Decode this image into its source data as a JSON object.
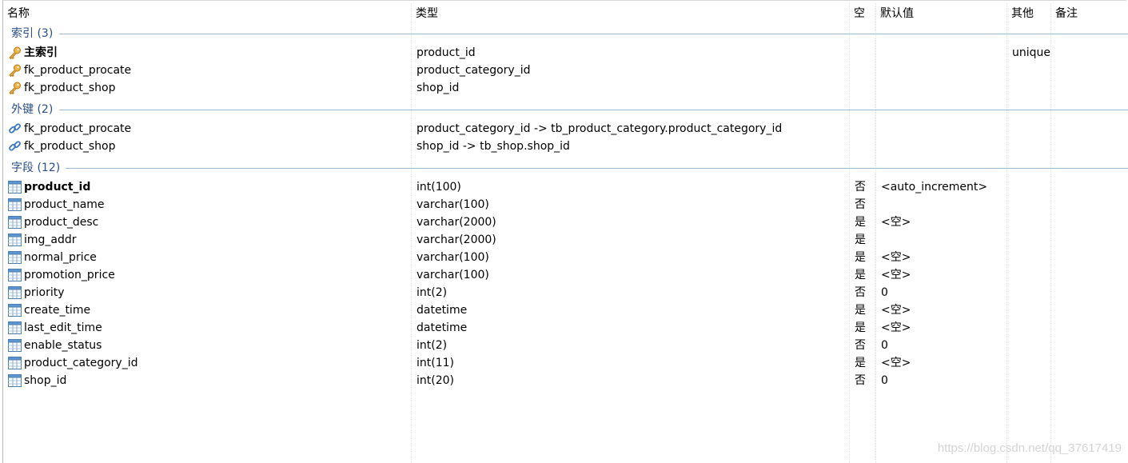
{
  "columns": {
    "name": "名称",
    "type": "类型",
    "null": "空",
    "default": "默认值",
    "other": "其他",
    "comment": "备注"
  },
  "groups": {
    "indexes": "索引 (3)",
    "foreign_keys": "外键 (2)",
    "fields": "字段 (12)"
  },
  "indexes": [
    {
      "name": "主索引",
      "type": "product_id",
      "other": "unique",
      "icon": "key-icon"
    },
    {
      "name": "fk_product_procate",
      "type": "product_category_id",
      "other": "",
      "icon": "key-icon"
    },
    {
      "name": "fk_product_shop",
      "type": "shop_id",
      "other": "",
      "icon": "key-icon"
    }
  ],
  "foreign_keys": [
    {
      "name": "fk_product_procate",
      "type": "product_category_id -> tb_product_category.product_category_id",
      "icon": "link-icon"
    },
    {
      "name": "fk_product_shop",
      "type": "shop_id -> tb_shop.shop_id",
      "icon": "link-icon"
    }
  ],
  "fields": [
    {
      "name": "product_id",
      "type": "int(100)",
      "null": "否",
      "default": "<auto_increment>"
    },
    {
      "name": "product_name",
      "type": "varchar(100)",
      "null": "否",
      "default": ""
    },
    {
      "name": "product_desc",
      "type": "varchar(2000)",
      "null": "是",
      "default": "<空>"
    },
    {
      "name": "img_addr",
      "type": "varchar(2000)",
      "null": "是",
      "default": ""
    },
    {
      "name": "normal_price",
      "type": "varchar(100)",
      "null": "是",
      "default": "<空>"
    },
    {
      "name": "promotion_price",
      "type": "varchar(100)",
      "null": "是",
      "default": "<空>"
    },
    {
      "name": "priority",
      "type": "int(2)",
      "null": "否",
      "default": "0"
    },
    {
      "name": "create_time",
      "type": "datetime",
      "null": "是",
      "default": "<空>"
    },
    {
      "name": "last_edit_time",
      "type": "datetime",
      "null": "是",
      "default": "<空>"
    },
    {
      "name": "enable_status",
      "type": "int(2)",
      "null": "否",
      "default": "0"
    },
    {
      "name": "product_category_id",
      "type": "int(11)",
      "null": "是",
      "default": "<空>"
    },
    {
      "name": "shop_id",
      "type": "int(20)",
      "null": "否",
      "default": "0"
    }
  ],
  "watermark": "https://blog.csdn.net/qq_37617419",
  "colors": {
    "group_text": "#2a4f8a",
    "key_icon": "#e8a23a",
    "link_icon": "#3a78c8",
    "table_icon": "#4a86c5"
  }
}
